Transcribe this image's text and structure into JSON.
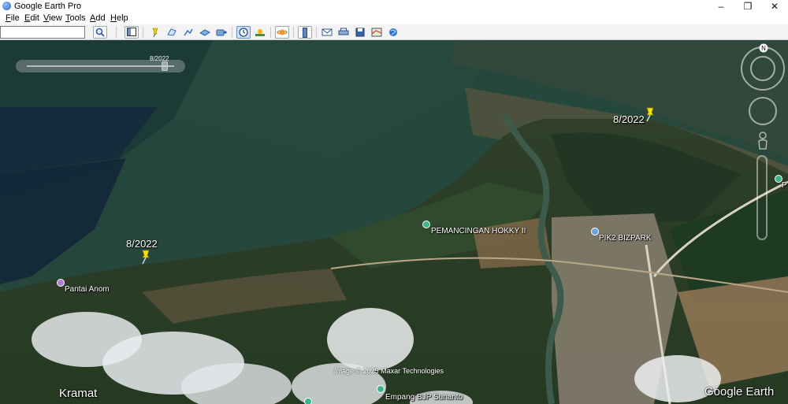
{
  "window": {
    "title": "Google Earth Pro",
    "controls": {
      "minimize": "–",
      "maximize": "❐",
      "close": "✕"
    }
  },
  "menu": {
    "items": [
      {
        "ul": "F",
        "rest": "ile"
      },
      {
        "ul": "E",
        "rest": "dit"
      },
      {
        "ul": "V",
        "rest": "iew"
      },
      {
        "ul": "T",
        "rest": "ools"
      },
      {
        "ul": "A",
        "rest": "dd"
      },
      {
        "ul": "H",
        "rest": "elp"
      }
    ]
  },
  "search": {
    "value": "",
    "icon": "search-icon"
  },
  "toolbar": {
    "icons": [
      "sidebar-toggle-icon",
      "placemark-icon",
      "polygon-icon",
      "path-icon",
      "image-overlay-icon",
      "record-tour-icon",
      "historical-imagery-icon",
      "sunlight-icon",
      "planets-icon",
      "ruler-icon",
      "email-icon",
      "print-icon",
      "save-image-icon",
      "maps-icon",
      "web-icon"
    ]
  },
  "timeline": {
    "date": "8/2022"
  },
  "pins": [
    {
      "label": "8/2022"
    },
    {
      "label": "8/2022"
    }
  ],
  "places": [
    {
      "label": "Pantai Anom",
      "color": "#b07ad8"
    },
    {
      "label": "PEMANCINGAN HOKKY II",
      "color": "#3bb58b"
    },
    {
      "label": "PIK2 BIZPARK",
      "color": "#6aa4e0"
    },
    {
      "label": "Empang BJP Sunanto",
      "color": "#3bb58b"
    },
    {
      "label": "P",
      "color": "#3bb58b"
    }
  ],
  "regions": {
    "kramat": "Kramat"
  },
  "copyright": "Image © 2025 Maxar Technologies",
  "brand": "Google Earth",
  "compass": {
    "north": "N"
  }
}
